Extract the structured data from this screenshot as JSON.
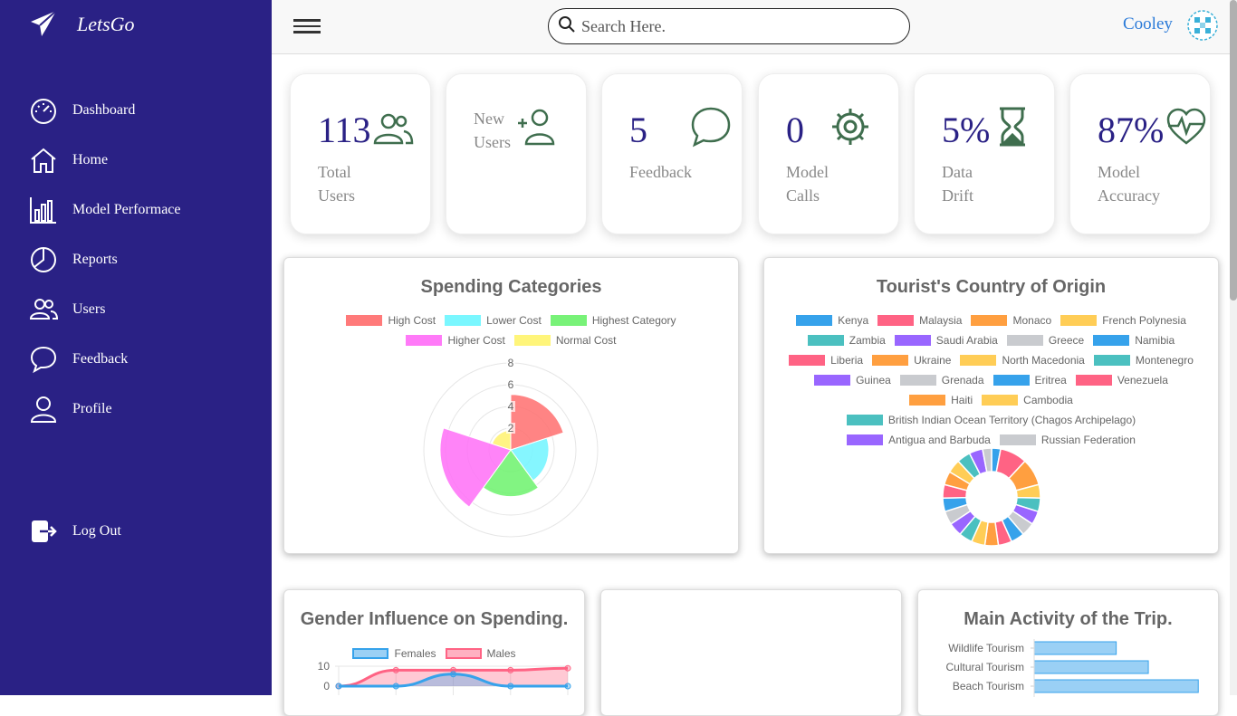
{
  "brand": {
    "name": "LetsGo",
    "icon": "paper-plane-icon"
  },
  "sidebar": {
    "items": [
      {
        "label": "Dashboard",
        "icon": "speedometer-icon"
      },
      {
        "label": "Home",
        "icon": "home-icon"
      },
      {
        "label": "Model Performace",
        "icon": "bar-chart-icon"
      },
      {
        "label": "Reports",
        "icon": "pie-chart-icon"
      },
      {
        "label": "Users",
        "icon": "users-icon"
      },
      {
        "label": "Feedback",
        "icon": "chat-icon"
      },
      {
        "label": "Profile",
        "icon": "person-icon"
      }
    ],
    "logout": {
      "label": "Log Out",
      "icon": "logout-icon"
    }
  },
  "topbar": {
    "search_placeholder": "Search Here.",
    "username": "Cooley"
  },
  "cards": [
    {
      "value": "113",
      "name": "Total Users",
      "icon": "users-icon"
    },
    {
      "value": "",
      "name": "New Users",
      "icon": "add-user-icon"
    },
    {
      "value": "5",
      "name": "Feedback",
      "icon": "chat-bubble-icon"
    },
    {
      "value": "0",
      "name": "Model Calls",
      "icon": "gear-icon"
    },
    {
      "value": "5%",
      "name": "Data Drift",
      "icon": "hourglass-icon"
    },
    {
      "value": "87%",
      "name": "Model Accuracy",
      "icon": "heart-pulse-icon"
    }
  ],
  "colors": {
    "sidebar": "#2a2185",
    "accent": "#2a2185",
    "icon_green": "#3f6e4e",
    "username": "#2a7ad8"
  },
  "chart_data": [
    {
      "type": "polarArea",
      "title": "Spending Categories",
      "categories": [
        "High Cost",
        "Lower Cost",
        "Highest Category",
        "Higher Cost",
        "Normal Cost"
      ],
      "values": [
        5.1,
        3.5,
        4.3,
        6.5,
        1.8
      ],
      "colors": [
        "#ff6f6f",
        "#70f5ff",
        "#6cf26c",
        "#ff6ef7",
        "#fff26e"
      ],
      "ticks": [
        "2",
        "4",
        "6",
        "8"
      ],
      "rmax": 8
    },
    {
      "type": "doughnut",
      "title": "Tourist's Country of Origin",
      "categories": [
        "Kenya",
        "Malaysia",
        "Monaco",
        "French Polynesia",
        "Zambia",
        "Saudi Arabia",
        "Greece",
        "Namibia",
        "Liberia",
        "Ukraine",
        "North Macedonia",
        "Montenegro",
        "Guinea",
        "Grenada",
        "Eritrea",
        "Venezuela",
        "Haiti",
        "Cambodia",
        "British Indian Ocean Territory (Chagos Archipelago)",
        "Antigua and Barbuda",
        "Russian Federation"
      ],
      "values": [
        2,
        6,
        6,
        3,
        3,
        3,
        3,
        3,
        3,
        3,
        3,
        3,
        3,
        3,
        3,
        3,
        3,
        3,
        3,
        3,
        2
      ],
      "palette": [
        "#36a2eb",
        "#ff6384",
        "#ff9f40",
        "#ffcd56",
        "#4bc0c0",
        "#9966ff",
        "#c9cbcf"
      ]
    },
    {
      "type": "area",
      "title": "Gender Influence on Spending.",
      "x": [
        "1",
        "2",
        "3",
        "4",
        "5"
      ],
      "series": [
        {
          "name": "Females",
          "values": [
            0,
            0,
            6,
            0,
            0
          ]
        },
        {
          "name": "Males",
          "values": [
            0,
            8,
            8,
            8,
            9
          ]
        }
      ],
      "yticks": [
        "10",
        "0"
      ],
      "ylim": [
        0,
        10
      ]
    },
    {
      "type": "bar",
      "title": "Main Activity of the Trip.",
      "categories": [
        "Wildlife Tourism",
        "Cultural Tourism",
        "Beach Tourism"
      ],
      "values": [
        23,
        32,
        46
      ],
      "xlim": [
        0,
        50
      ]
    }
  ]
}
